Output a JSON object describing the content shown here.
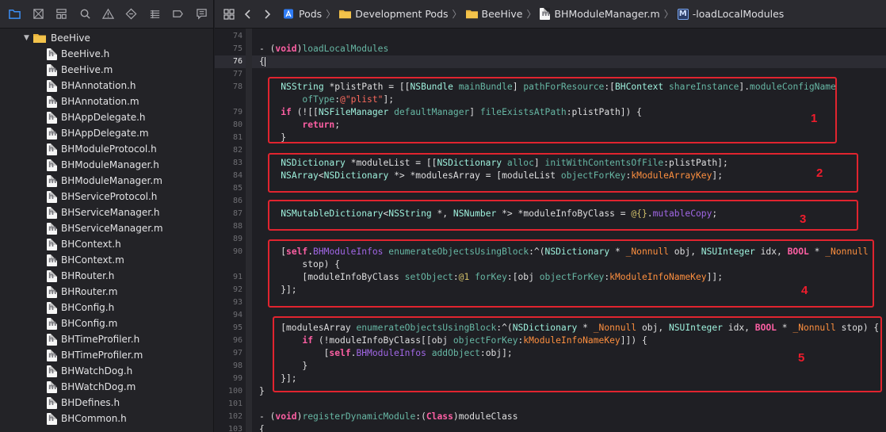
{
  "navigator": {
    "tools": [
      "folder-icon",
      "source-control-icon",
      "hierarchy-icon",
      "search-icon",
      "warning-icon",
      "test-icon",
      "debug-icon",
      "breakpoint-icon",
      "report-icon"
    ],
    "group": "BeeHive",
    "files": [
      {
        "name": "BeeHive.h",
        "type": "h"
      },
      {
        "name": "BeeHive.m",
        "type": "m"
      },
      {
        "name": "BHAnnotation.h",
        "type": "h"
      },
      {
        "name": "BHAnnotation.m",
        "type": "m"
      },
      {
        "name": "BHAppDelegate.h",
        "type": "h"
      },
      {
        "name": "BHAppDelegate.m",
        "type": "m"
      },
      {
        "name": "BHModuleProtocol.h",
        "type": "h"
      },
      {
        "name": "BHModuleManager.h",
        "type": "h"
      },
      {
        "name": "BHModuleManager.m",
        "type": "m"
      },
      {
        "name": "BHServiceProtocol.h",
        "type": "h"
      },
      {
        "name": "BHServiceManager.h",
        "type": "h"
      },
      {
        "name": "BHServiceManager.m",
        "type": "m"
      },
      {
        "name": "BHContext.h",
        "type": "h"
      },
      {
        "name": "BHContext.m",
        "type": "m"
      },
      {
        "name": "BHRouter.h",
        "type": "h"
      },
      {
        "name": "BHRouter.m",
        "type": "m"
      },
      {
        "name": "BHConfig.h",
        "type": "h"
      },
      {
        "name": "BHConfig.m",
        "type": "m"
      },
      {
        "name": "BHTimeProfiler.h",
        "type": "h"
      },
      {
        "name": "BHTimeProfiler.m",
        "type": "m"
      },
      {
        "name": "BHWatchDog.h",
        "type": "h"
      },
      {
        "name": "BHWatchDog.m",
        "type": "m"
      },
      {
        "name": "BHDefines.h",
        "type": "h"
      },
      {
        "name": "BHCommon.h",
        "type": "h"
      }
    ]
  },
  "jumpbar": {
    "crumbs": [
      "Pods",
      "Development Pods",
      "BeeHive",
      "BHModuleManager.m",
      "-loadLocalModules"
    ],
    "method_badge": "M"
  },
  "editor": {
    "current_line": 76,
    "lines": [
      {
        "n": 74,
        "html": ""
      },
      {
        "n": 75,
        "html": "- (<span class='kw'>void</span>)<span class='mth'>loadLocalModules</span>"
      },
      {
        "n": 76,
        "html": "{<span class='cursor'></span>"
      },
      {
        "n": 77,
        "html": ""
      },
      {
        "n": 78,
        "html": "    <span class='cls'>NSString</span> *plistPath = [[<span class='cls'>NSBundle</span> <span class='mth'>mainBundle</span>] <span class='mth'>pathForResource</span>:[<span class='cls'>BHContext</span> <span class='mth'>shareInstance</span>].<span class='mth'>moduleConfigName</span>"
      },
      {
        "n": 0,
        "html": "        <span class='mth'>ofType</span>:<span class='str'>@\"plist\"</span>];"
      },
      {
        "n": 79,
        "html": "    <span class='kw'>if</span> (![[<span class='cls'>NSFileManager</span> <span class='mth'>defaultManager</span>] <span class='mth'>fileExistsAtPath</span>:plistPath]) {"
      },
      {
        "n": 80,
        "html": "        <span class='kw'>return</span>;"
      },
      {
        "n": 81,
        "html": "    }"
      },
      {
        "n": 82,
        "html": ""
      },
      {
        "n": 83,
        "html": "    <span class='cls'>NSDictionary</span> *moduleList = [[<span class='cls'>NSDictionary</span> <span class='mth'>alloc</span>] <span class='mth'>initWithContentsOfFile</span>:plistPath];"
      },
      {
        "n": 84,
        "html": "    <span class='cls'>NSArray</span>&lt;<span class='cls'>NSDictionary</span> *&gt; *modulesArray = [moduleList <span class='mth'>objectForKey</span>:<span class='cst'>kModuleArrayKey</span>];"
      },
      {
        "n": 85,
        "html": ""
      },
      {
        "n": 86,
        "html": ""
      },
      {
        "n": 87,
        "html": "    <span class='cls'>NSMutableDictionary</span>&lt;<span class='cls'>NSString</span> *, <span class='cls'>NSNumber</span> *&gt; *moduleInfoByClass = <span class='num'>@{}</span>.<span class='prp'>mutableCopy</span>;"
      },
      {
        "n": 88,
        "html": ""
      },
      {
        "n": 89,
        "html": ""
      },
      {
        "n": 90,
        "html": "    [<span class='kw'>self</span>.<span class='prp'>BHModuleInfos</span> <span class='mth'>enumerateObjectsUsingBlock</span>:^(<span class='cls'>NSDictionary</span> * <span class='cst'>_Nonnull</span> obj, <span class='cls'>NSUInteger</span> idx, <span class='kw'>BOOL</span> * <span class='cst'>_Nonnull</span>"
      },
      {
        "n": 0,
        "html": "        stop) {"
      },
      {
        "n": 91,
        "html": "        [moduleInfoByClass <span class='mth'>setObject</span>:<span class='num'>@1</span> <span class='mth'>forKey</span>:[obj <span class='mth'>objectForKey</span>:<span class='cst'>kModuleInfoNameKey</span>]];"
      },
      {
        "n": 92,
        "html": "    }];"
      },
      {
        "n": 93,
        "html": ""
      },
      {
        "n": 94,
        "html": ""
      },
      {
        "n": 95,
        "html": "    [modulesArray <span class='mth'>enumerateObjectsUsingBlock</span>:^(<span class='cls'>NSDictionary</span> * <span class='cst'>_Nonnull</span> obj, <span class='cls'>NSUInteger</span> idx, <span class='kw'>BOOL</span> * <span class='cst'>_Nonnull</span> stop) {"
      },
      {
        "n": 96,
        "html": "        <span class='kw'>if</span> (!moduleInfoByClass[[obj <span class='mth'>objectForKey</span>:<span class='cst'>kModuleInfoNameKey</span>]]) {"
      },
      {
        "n": 97,
        "html": "            [<span class='kw'>self</span>.<span class='prp'>BHModuleInfos</span> <span class='mth'>addObject</span>:obj];"
      },
      {
        "n": 98,
        "html": "        }"
      },
      {
        "n": 99,
        "html": "    }];"
      },
      {
        "n": 100,
        "html": "}"
      },
      {
        "n": 101,
        "html": ""
      },
      {
        "n": 102,
        "html": "- (<span class='kw'>void</span>)<span class='mth'>registerDynamicModule</span>:(<span class='kw'>Class</span>)moduleClass"
      },
      {
        "n": 103,
        "html": "{"
      }
    ]
  },
  "annotations": [
    "1",
    "2",
    "3",
    "4",
    "5"
  ]
}
